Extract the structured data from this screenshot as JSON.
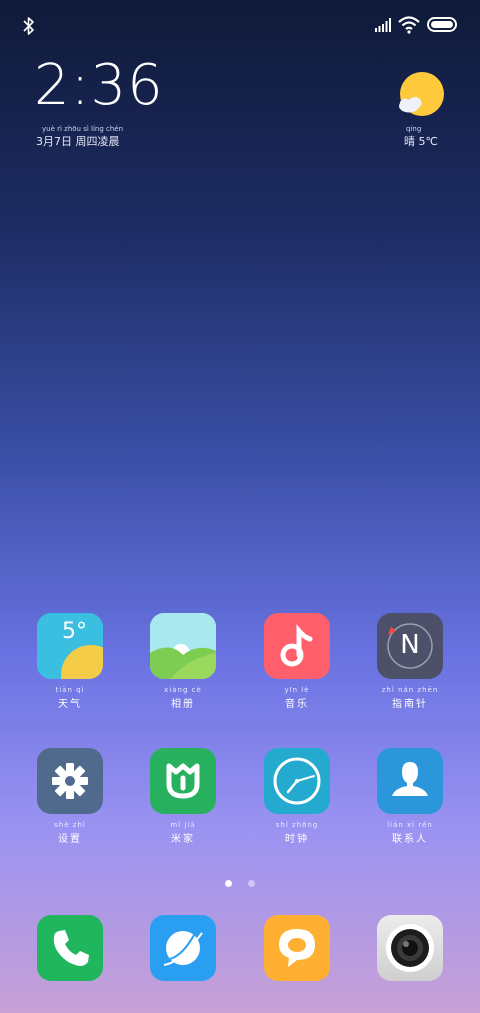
{
  "status_bar": {
    "icons": [
      "bluetooth-icon",
      "signal-icon",
      "wifi-icon",
      "battery-icon"
    ]
  },
  "clock": {
    "time": "2:36",
    "date_pinyin": "yuè   rì   zhōu  sì  líng chén",
    "date": "3月7日 周四凌晨"
  },
  "weather": {
    "condition_pinyin": "qíng",
    "condition_temp": "晴 5℃"
  },
  "apps_row1": [
    {
      "pinyin": "tiān  qì",
      "label": "天气",
      "icon": "weather-app-icon",
      "temp": "5°"
    },
    {
      "pinyin": "xiàng  cè",
      "label": "相册",
      "icon": "gallery-app-icon"
    },
    {
      "pinyin": "yīn  lè",
      "label": "音乐",
      "icon": "music-app-icon"
    },
    {
      "pinyin": "zhǐ nán zhēn",
      "label": "指南针",
      "icon": "compass-app-icon",
      "letter": "N"
    }
  ],
  "apps_row2": [
    {
      "pinyin": "shè  zhì",
      "label": "设置",
      "icon": "settings-app-icon"
    },
    {
      "pinyin": "mǐ  jiā",
      "label": "米家",
      "icon": "mijia-app-icon"
    },
    {
      "pinyin": "shí zhōng",
      "label": "时钟",
      "icon": "clock-app-icon"
    },
    {
      "pinyin": "lián  xì  rén",
      "label": "联系人",
      "icon": "contacts-app-icon"
    }
  ],
  "page_indicator": {
    "pages": 2,
    "current": 0
  },
  "dock": [
    {
      "icon": "phone-app-icon"
    },
    {
      "icon": "browser-app-icon"
    },
    {
      "icon": "messages-app-icon"
    },
    {
      "icon": "camera-app-icon"
    }
  ],
  "colors": {
    "weather": "#3bbfe0",
    "gallery": "#8bd36a",
    "music": "#ff5f6b",
    "compass": "#4c5068",
    "settings": "#4f6a8c",
    "mijia": "#27b15f",
    "clock": "#25aacf",
    "contacts": "#2b97da",
    "phone": "#1fb65e",
    "browser": "#2a9ef0",
    "messages": "#ffb032",
    "camera": "#d9d9d9"
  }
}
